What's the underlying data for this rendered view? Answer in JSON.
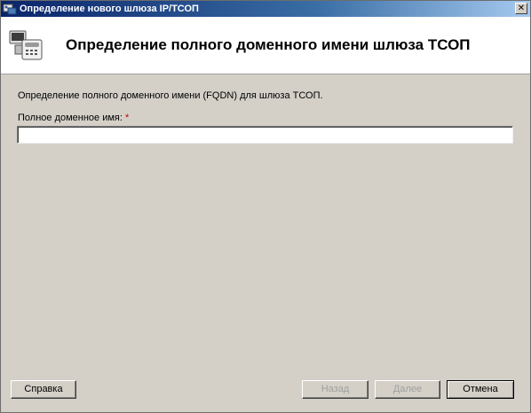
{
  "window": {
    "title": "Определение нового шлюза IP/ТСОП",
    "close_label": "✕"
  },
  "header": {
    "icon": "phone-gateway-icon",
    "title": "Определение полного доменного имени шлюза ТСОП"
  },
  "form": {
    "description": "Определение полного доменного имени (FQDN) для шлюза ТСОП.",
    "fqdn_label": "Полное доменное имя:",
    "required_marker": "*",
    "fqdn_value": ""
  },
  "buttons": {
    "help": "Справка",
    "back": "Назад",
    "next": "Далее",
    "cancel": "Отмена"
  }
}
